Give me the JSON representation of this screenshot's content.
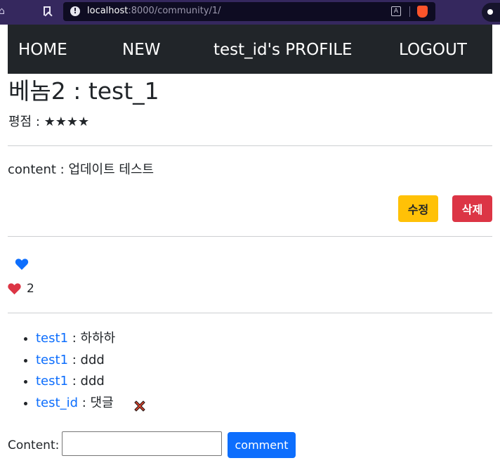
{
  "browser": {
    "url_host": "localhost",
    "url_rest": ":8000/community/1/"
  },
  "nav": {
    "home": "HOME",
    "new": "NEW",
    "profile": "test_id's PROFILE",
    "logout": "LOGOUT"
  },
  "review": {
    "title": "베놈2 : test_1",
    "rating_label": "평점 : ",
    "rating_stars": "★★★★",
    "rating_value": 4,
    "content_label": "content : ",
    "content": "업데이트 테스트",
    "edit_button": "수정",
    "delete_button": "삭제"
  },
  "likes": {
    "count": "2"
  },
  "comments": [
    {
      "author": "test1",
      "separator": " : ",
      "text": "하하하"
    },
    {
      "author": "test1",
      "separator": " : ",
      "text": "ddd"
    },
    {
      "author": "test1",
      "separator": " : ",
      "text": "ddd"
    },
    {
      "author": "test_id",
      "separator": " : ",
      "text": "댓글"
    }
  ],
  "comment_form": {
    "label": "Content:",
    "value": "",
    "submit_label": "comment"
  },
  "colors": {
    "navbar": "#212529",
    "primary": "#0d6efd",
    "warning": "#ffc107",
    "danger": "#dc3545"
  }
}
